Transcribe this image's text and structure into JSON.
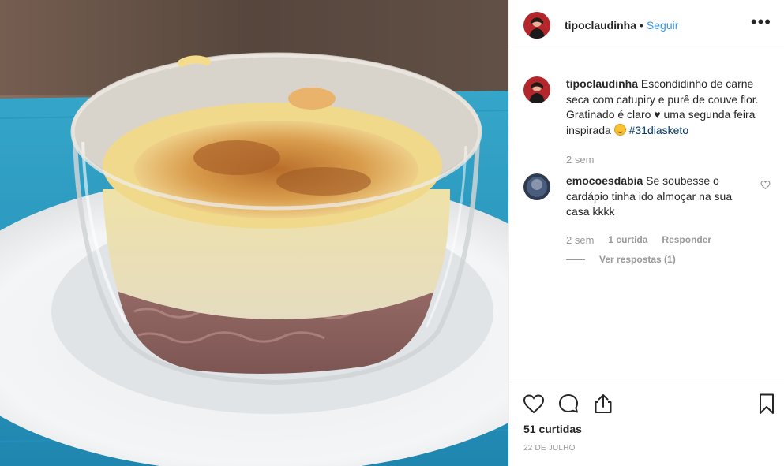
{
  "post": {
    "username": "tipoclaudinha",
    "separator": "•",
    "follow_label": "Seguir",
    "more_label": "•••"
  },
  "caption": {
    "username": "tipoclaudinha",
    "text_before": "Escondidinho de carne seca com catupiry e purê de couve flor. Gratinado é claro ♥ uma segunda feira inspirada",
    "emoji": "smiling-face-emoji",
    "hashtag": "#31diasketo",
    "time": "2 sem"
  },
  "comment": {
    "username": "emocoesdabia",
    "text": "Se soubesse o cardápio tinha ido almoçar na sua casa kkkk",
    "time": "2 sem",
    "likes": "1 curtida",
    "reply_label": "Responder",
    "view_replies": "Ver respostas (1)"
  },
  "actions": {
    "like_icon": "heart-icon",
    "comment_icon": "comment-icon",
    "share_icon": "share-icon",
    "save_icon": "bookmark-icon",
    "likes_count": "51 curtidas",
    "date": "22 DE JULHO"
  },
  "colors": {
    "link_blue": "#3897f0",
    "hashtag": "#003569",
    "muted": "#999999",
    "text": "#262626",
    "border": "#efefef"
  }
}
